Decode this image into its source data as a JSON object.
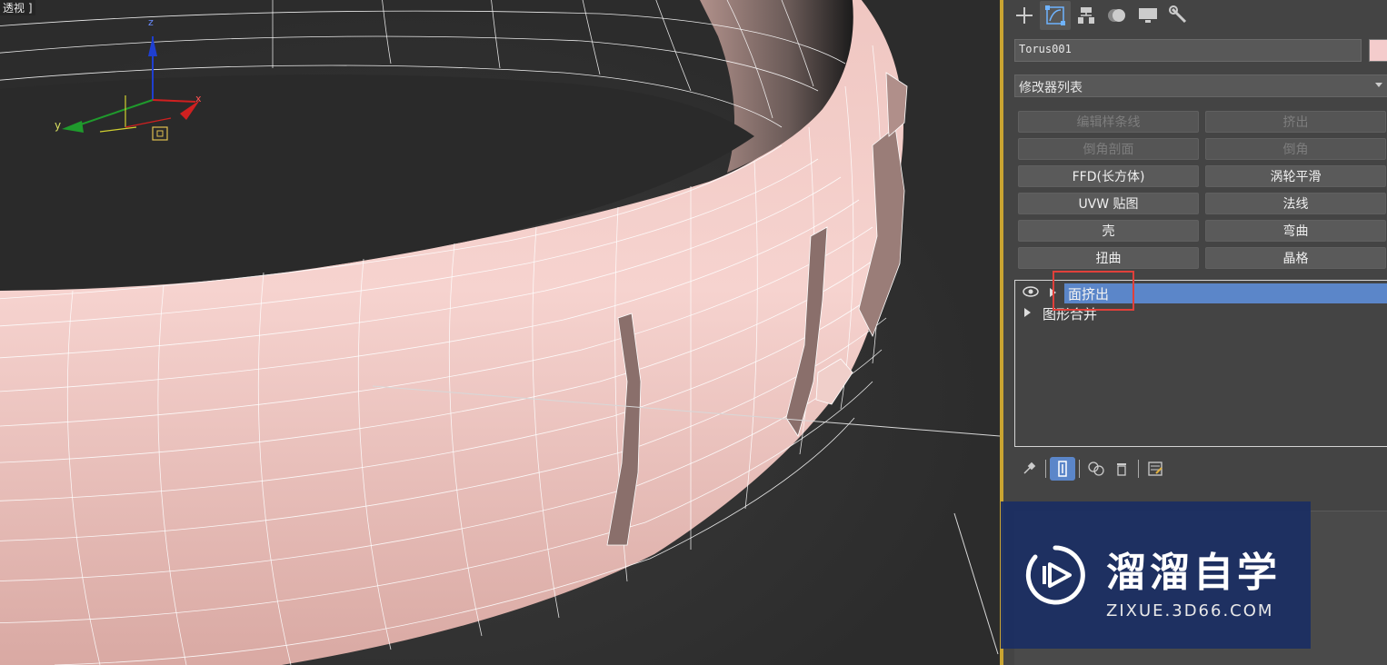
{
  "viewport": {
    "label": "透视 ]",
    "axis_labels": {
      "x": "x",
      "y": "y",
      "z": "z"
    }
  },
  "command_panel": {
    "tabs": [
      {
        "icon": "create-plus-icon"
      },
      {
        "icon": "modify-icon",
        "active": true
      },
      {
        "icon": "hierarchy-icon"
      },
      {
        "icon": "motion-icon"
      },
      {
        "icon": "display-icon"
      },
      {
        "icon": "utilities-wrench-icon"
      }
    ],
    "object_name": "Torus001",
    "object_color": "#f4cccc",
    "modifier_list_label": "修改器列表",
    "modifier_buttons": [
      {
        "label": "编辑样条线",
        "enabled": false
      },
      {
        "label": "挤出",
        "enabled": false
      },
      {
        "label": "倒角剖面",
        "enabled": false
      },
      {
        "label": "倒角",
        "enabled": false
      },
      {
        "label": "FFD(长方体)",
        "enabled": true
      },
      {
        "label": "涡轮平滑",
        "enabled": true
      },
      {
        "label": "UVW 贴图",
        "enabled": true
      },
      {
        "label": "法线",
        "enabled": true
      },
      {
        "label": "壳",
        "enabled": true
      },
      {
        "label": "弯曲",
        "enabled": true
      },
      {
        "label": "扭曲",
        "enabled": true
      },
      {
        "label": "晶格",
        "enabled": true
      }
    ],
    "stack": [
      {
        "label": "面挤出",
        "selected": true
      },
      {
        "label": "图形合并",
        "selected": false
      }
    ],
    "stack_tools": [
      "pin-icon",
      "show-end-result-icon",
      "make-unique-icon",
      "remove-modifier-icon",
      "configure-sets-icon"
    ]
  },
  "watermark": {
    "title": "溜溜自学",
    "url": "ZIXUE.3D66.COM"
  },
  "colors": {
    "selection": "#5b86c9",
    "highlight_box": "#e0403a",
    "active_border": "#c9a431",
    "torus": "#f3cfcb",
    "wire": "#ffffff"
  }
}
